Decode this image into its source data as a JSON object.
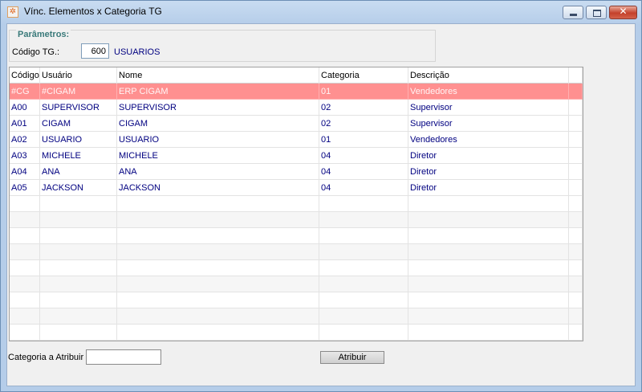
{
  "window": {
    "title": "Vínc. Elementos x Categoria TG",
    "icon": "app-icon",
    "close_glyph": "✕"
  },
  "parametros": {
    "legend": "Parâmetros:",
    "codigo_label": "Código TG.:",
    "codigo_value": "600",
    "codigo_desc": "USUARIOS"
  },
  "grid": {
    "columns": [
      "Código",
      "Usuário",
      "Nome",
      "Categoria",
      "Descrição"
    ],
    "rows": [
      {
        "codigo": "#CG",
        "usuario": "#CIGAM",
        "nome": "ERP CIGAM",
        "categoria": "01",
        "descricao": "Vendedores",
        "selected": true
      },
      {
        "codigo": "A00",
        "usuario": "SUPERVISOR",
        "nome": "SUPERVISOR",
        "categoria": "02",
        "descricao": "Supervisor"
      },
      {
        "codigo": "A01",
        "usuario": "CIGAM",
        "nome": "CIGAM",
        "categoria": "02",
        "descricao": "Supervisor"
      },
      {
        "codigo": "A02",
        "usuario": "USUARIO",
        "nome": "USUARIO",
        "categoria": "01",
        "descricao": "Vendedores"
      },
      {
        "codigo": "A03",
        "usuario": "MICHELE",
        "nome": "MICHELE",
        "categoria": "04",
        "descricao": "Diretor"
      },
      {
        "codigo": "A04",
        "usuario": "ANA",
        "nome": "ANA",
        "categoria": "04",
        "descricao": "Diretor"
      },
      {
        "codigo": "A05",
        "usuario": "JACKSON",
        "nome": "JACKSON",
        "categoria": "04",
        "descricao": "Diretor"
      }
    ]
  },
  "footer": {
    "categoria_label": "Categoria a Atribuir",
    "categoria_value": "",
    "atribuir_label": "Atribuir"
  },
  "colors": {
    "selected_row": "#ff9090",
    "data_text": "#000080",
    "legend_text": "#3a7a7a"
  }
}
